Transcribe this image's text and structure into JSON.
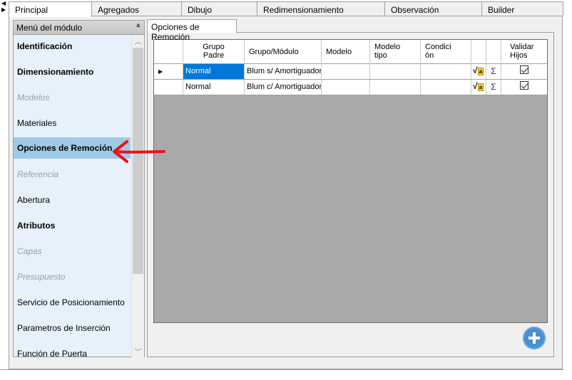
{
  "tabs": [
    {
      "label": "Principal",
      "active": true
    },
    {
      "label": "Agregados"
    },
    {
      "label": "Dibujo"
    },
    {
      "label": "Redimensionamiento"
    },
    {
      "label": "Observación"
    },
    {
      "label": "Builder"
    }
  ],
  "menu": {
    "title": "Menú del módulo",
    "items": [
      {
        "label": "Identificación",
        "style": "bold"
      },
      {
        "label": "Dimensionamiento",
        "style": "bold"
      },
      {
        "label": "Modelos",
        "style": "disabled"
      },
      {
        "label": "Materiales",
        "style": "normal"
      },
      {
        "label": "Opciones de Remoción",
        "style": "selected"
      },
      {
        "label": "Referencia",
        "style": "disabled"
      },
      {
        "label": "Abertura",
        "style": "normal"
      },
      {
        "label": "Atributos",
        "style": "bold"
      },
      {
        "label": "Capas",
        "style": "disabled"
      },
      {
        "label": "Presupuesto",
        "style": "disabled"
      },
      {
        "label": "Servicio de Posicionamiento",
        "style": "normal"
      },
      {
        "label": "Parametros de Inserción",
        "style": "normal"
      },
      {
        "label": "Función de Puerta",
        "style": "normal"
      }
    ]
  },
  "content": {
    "tab_label": "Opciones de Remoción",
    "grid": {
      "headers": {
        "grupo_padre": [
          "Grupo",
          "Padre"
        ],
        "grupo_modulo": "Grupo/Módulo",
        "modelo": "Modelo",
        "modelo_tipo": [
          "Modelo",
          "tipo"
        ],
        "condicion": [
          "Condici",
          "ón"
        ],
        "validar_hijos": [
          "Validar",
          "Hijos"
        ]
      },
      "rows": [
        {
          "grupo_padre": "Normal",
          "grupo_modulo": "Blum s/ Amortiguador",
          "modelo": "",
          "modelo_tipo": "",
          "condicion": "",
          "sigma": "Σ",
          "validar_hijos": true,
          "current": true
        },
        {
          "grupo_padre": "Normal",
          "grupo_modulo": "Blum c/ Amortiguador",
          "modelo": "",
          "modelo_tipo": "",
          "condicion": "",
          "sigma": "Σ",
          "validar_hijos": true,
          "current": false
        }
      ]
    }
  },
  "colors": {
    "selection": "#0078d7",
    "menu_selected": "#9fcbe6",
    "menu_bg": "#e6f1fb",
    "grid_empty": "#a9a9a9",
    "annotation_arrow": "#e8141a",
    "add_button": "#4a90d0"
  }
}
